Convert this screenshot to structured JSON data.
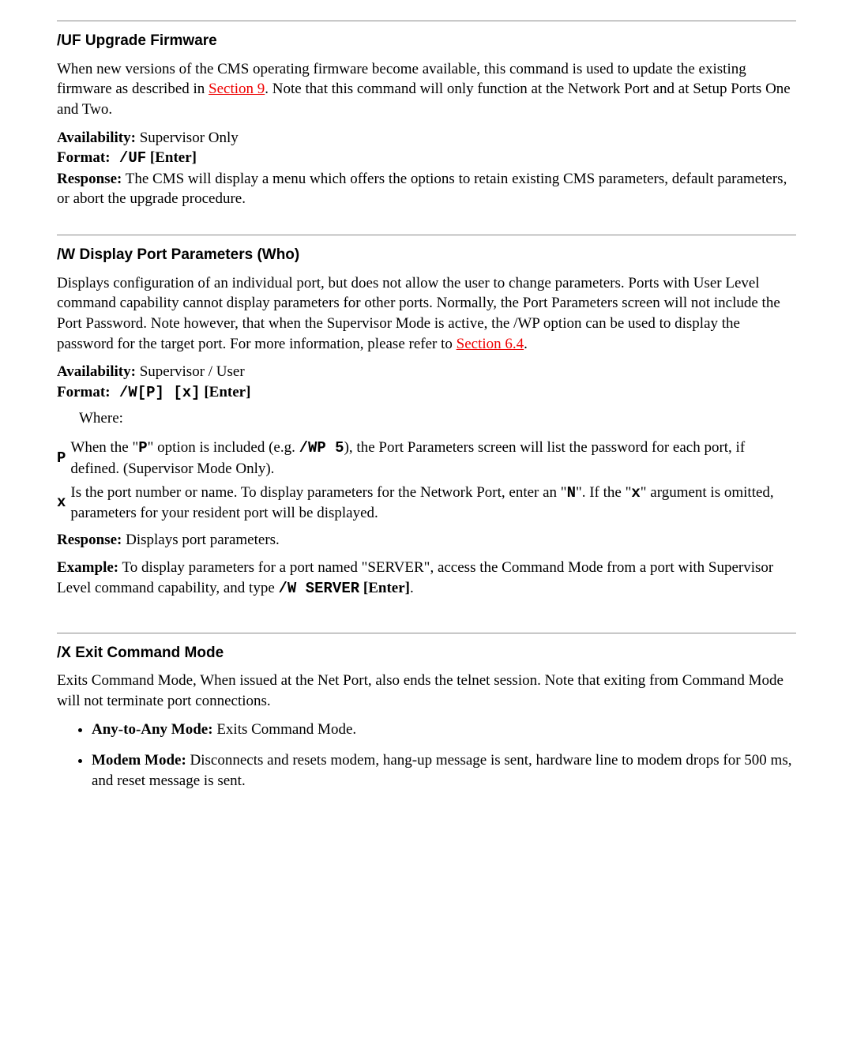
{
  "uf": {
    "heading_abbrev": "/UF",
    "heading_title": "Upgrade Firmware",
    "body1_a": "When new versions of the CMS operating firmware become available, this command is used to update the existing firmware as described in ",
    "body1_link": "Section 9",
    "body1_b": ". Note that this command will only function at the Network Port and at Setup Ports One and Two.",
    "avail_label": "Availability:",
    "avail_value": "  Supervisor Only",
    "format_label": "Format:",
    "format_value": " /UF",
    "format_trail": " [Enter]",
    "response_label": "Response:",
    "response_value": "  The CMS will display a menu which offers the options to retain existing CMS parameters, default parameters, or abort the upgrade procedure."
  },
  "w": {
    "heading_abbrev": "/W",
    "heading_title": "Display Port Parameters (Who)",
    "body1_a": "Displays configuration of an individual port, but does not allow the user to change parameters.  Ports with User Level command capability cannot display parameters for other ports. Normally, the Port Parameters screen will not include the Port Password. Note however, that when the Supervisor Mode is active, the /WP option can be used to display the password for the target port. For more information, please refer to ",
    "body1_link": "Section 6.4",
    "body1_b": ".",
    "avail_label": "Availability:",
    "avail_value": "  Supervisor / User",
    "format_label": "Format:",
    "format_value": " /W[P] [x]",
    "format_trail": " [Enter]",
    "where_label": "Where:",
    "row_p_key": "P",
    "row_p_a": "When the \"",
    "row_p_code1": "P",
    "row_p_b": "\" option is included (e.g. ",
    "row_p_code2": "/WP 5",
    "row_p_c": "), the Port Parameters screen will list the password for each port, if defined. (Supervisor Mode Only).",
    "row_x_key": "x",
    "row_x_a": "Is the port number or name. To display parameters for the Network Port, enter an \"",
    "row_x_code1": "N",
    "row_x_b": "\". If the \"",
    "row_x_code2": "x",
    "row_x_c": "\" argument is omitted, parameters for your resident port will be displayed.",
    "response_label": "Response:",
    "response_value": "  Displays port parameters.",
    "example_label": "Example:",
    "example_a": " To display parameters for a port named \"SERVER\", access the Command Mode from a port with Supervisor Level command capability, and type ",
    "example_code": "/W SERVER",
    "example_b": " [Enter]",
    "example_c": "."
  },
  "x": {
    "heading_abbrev": "/X",
    "heading_title": "Exit Command Mode",
    "body1": "Exits Command Mode, When issued at the Net Port, also ends the telnet session. Note that exiting from Command Mode will not terminate port connections.",
    "li1_label": "Any-to-Any Mode:",
    "li1_body": " Exits Command Mode.",
    "li2_label": "Modem Mode:",
    "li2_body": " Disconnects and resets modem, hang-up message is sent, hardware line to modem drops for 500 ms, and reset message is sent."
  }
}
